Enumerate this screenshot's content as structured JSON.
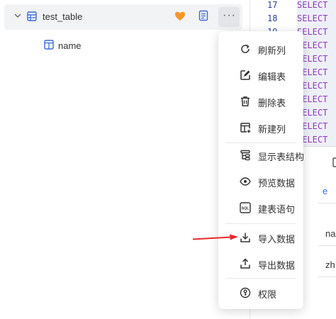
{
  "tree": {
    "table_name": "test_table",
    "more_label": "···",
    "column_name": "name"
  },
  "editor": {
    "line_numbers": [
      "17",
      "18",
      "19"
    ],
    "code_lines": [
      "SELECT",
      "SELECT",
      "SELECT",
      "SELECT",
      "SELECT",
      "SELECT",
      "SELECT",
      "SELECT",
      "SELECT",
      "SELECT",
      "SELECT"
    ],
    "fragments": {
      "char_e": "e",
      "na": "na",
      "zh": "zh"
    }
  },
  "menu": {
    "items": [
      {
        "label": "刷新列",
        "icon": "refresh-icon"
      },
      {
        "label": "编辑表",
        "icon": "edit-icon"
      },
      {
        "label": "删除表",
        "icon": "trash-icon"
      },
      {
        "label": "新建列",
        "icon": "add-column-icon"
      },
      {
        "label": "显示表结构",
        "icon": "structure-icon"
      },
      {
        "label": "预览数据",
        "icon": "eye-icon"
      },
      {
        "label": "建表语句",
        "icon": "sql-icon"
      },
      {
        "label": "导入数据",
        "icon": "import-icon"
      },
      {
        "label": "导出数据",
        "icon": "export-icon"
      },
      {
        "label": "权限",
        "icon": "permission-icon"
      }
    ]
  },
  "colors": {
    "accent_blue": "#3b6bd8",
    "favorite_orange": "#f5962b",
    "keyword_purple": "#8c3cb8",
    "arrow_red": "#e8282b"
  }
}
